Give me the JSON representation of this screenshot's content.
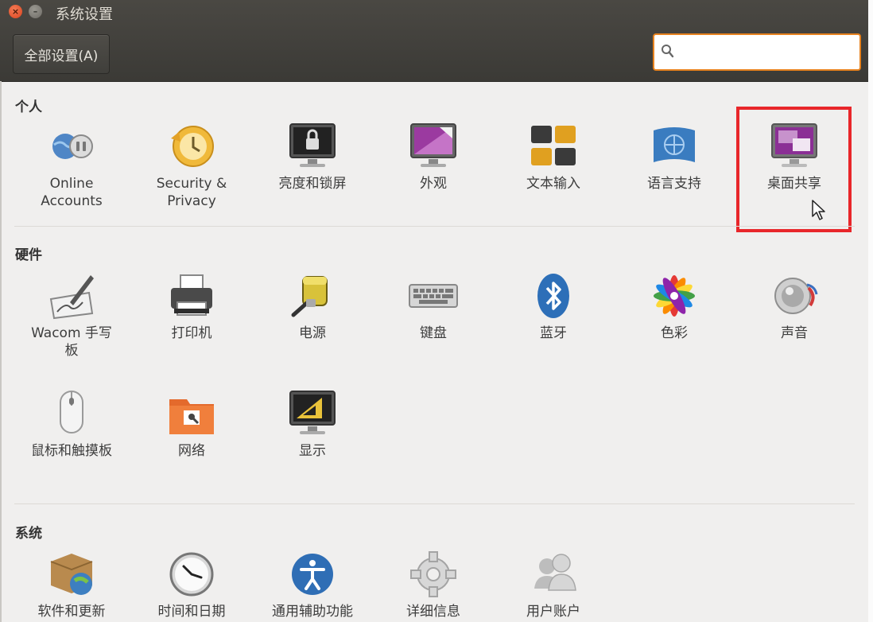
{
  "window": {
    "title": "系统设置"
  },
  "toolbar": {
    "all_settings_label": "全部设置(A)",
    "search_value": ""
  },
  "sections": {
    "personal": {
      "title": "个人",
      "items": [
        {
          "label": "Online\nAccounts",
          "icon": "online-accounts-icon"
        },
        {
          "label": "Security &\nPrivacy",
          "icon": "security-privacy-icon"
        },
        {
          "label": "亮度和锁屏",
          "icon": "brightness-lock-icon"
        },
        {
          "label": "外观",
          "icon": "appearance-icon"
        },
        {
          "label": "文本输入",
          "icon": "text-entry-icon"
        },
        {
          "label": "语言支持",
          "icon": "language-support-icon"
        },
        {
          "label": "桌面共享",
          "icon": "desktop-sharing-icon"
        }
      ]
    },
    "hardware": {
      "title": "硬件",
      "items": [
        {
          "label": "Wacom 手写\n板",
          "icon": "wacom-tablet-icon"
        },
        {
          "label": "打印机",
          "icon": "printer-icon"
        },
        {
          "label": "电源",
          "icon": "power-icon"
        },
        {
          "label": "键盘",
          "icon": "keyboard-icon"
        },
        {
          "label": "蓝牙",
          "icon": "bluetooth-icon"
        },
        {
          "label": "色彩",
          "icon": "color-icon"
        },
        {
          "label": "声音",
          "icon": "sound-icon"
        },
        {
          "label": "鼠标和触摸板",
          "icon": "mouse-touchpad-icon"
        },
        {
          "label": "网络",
          "icon": "network-icon"
        },
        {
          "label": "显示",
          "icon": "displays-icon"
        }
      ]
    },
    "system": {
      "title": "系统",
      "items": [
        {
          "label": "软件和更新",
          "icon": "software-updates-icon"
        },
        {
          "label": "时间和日期",
          "icon": "time-date-icon"
        },
        {
          "label": "通用辅助功能",
          "icon": "universal-access-icon"
        },
        {
          "label": "详细信息",
          "icon": "details-icon"
        },
        {
          "label": "用户账户",
          "icon": "user-accounts-icon"
        }
      ]
    }
  },
  "colors": {
    "highlight": "#e8262a",
    "titlebar": "#3f3e3a",
    "search_focus": "#e7821e"
  }
}
